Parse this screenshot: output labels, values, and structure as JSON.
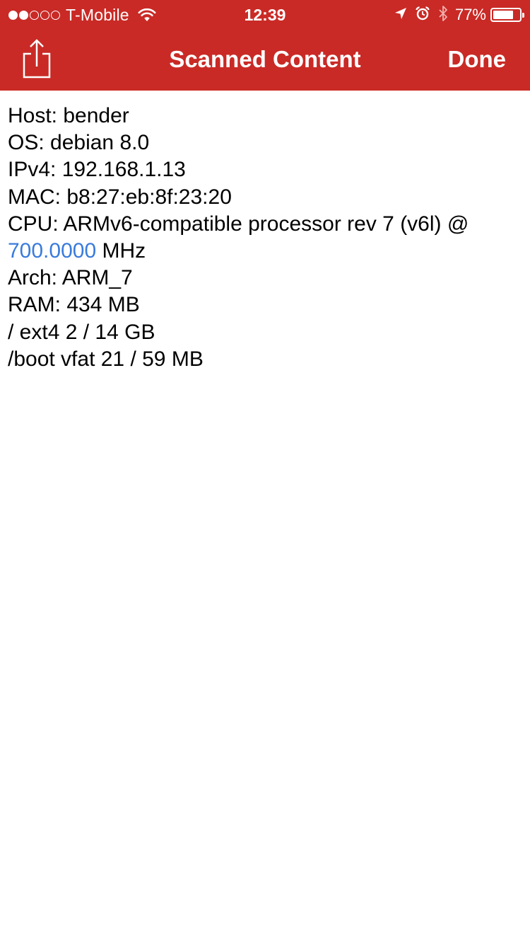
{
  "colors": {
    "header_bg": "#c92a26",
    "header_text": "#ffffff",
    "link": "#3a7bdc",
    "body_text": "#000000"
  },
  "status_bar": {
    "signal_bars_filled": 2,
    "signal_bars_total": 5,
    "carrier": "T-Mobile",
    "time": "12:39",
    "battery_percent": "77%",
    "battery_level": 0.77,
    "icons": [
      "wifi-icon",
      "location-arrow-icon",
      "alarm-icon",
      "bluetooth-icon",
      "battery-icon"
    ]
  },
  "nav": {
    "share_icon": "share-icon",
    "title": "Scanned Content",
    "done_label": "Done"
  },
  "content": {
    "lines": [
      "Host: bender",
      "OS: debian 8.0",
      "IPv4: 192.168.1.13",
      "MAC: b8:27:eb:8f:23:20",
      "CPU: ARMv6-compatible processor rev 7 (v6l) @"
    ],
    "cpu_freq_value": "700.0000",
    "cpu_freq_unit": " MHz",
    "lines_after": [
      "Arch: ARM_7",
      "RAM: 434 MB",
      "/ ext4 2 / 14 GB",
      "/boot vfat 21 / 59 MB"
    ]
  }
}
